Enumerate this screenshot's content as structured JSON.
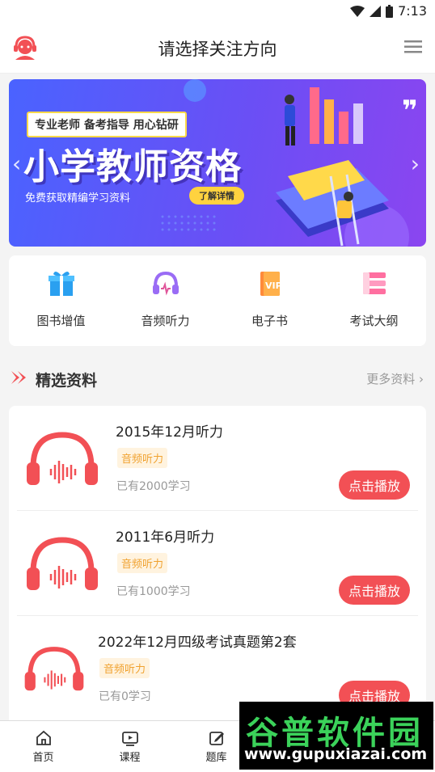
{
  "status": {
    "time": "7:13"
  },
  "header": {
    "title": "请选择关注方向"
  },
  "banner": {
    "tag": "专业老师 备考指导 用心钻研",
    "headline": "小学教师资格",
    "subtitle": "免费获取精编学习资料",
    "detail_button": "了解详情"
  },
  "quick_links": [
    {
      "label": "图书增值",
      "icon": "gift-box-icon"
    },
    {
      "label": "音频听力",
      "icon": "headphones-icon"
    },
    {
      "label": "电子书",
      "icon": "vip-book-icon"
    },
    {
      "label": "考试大纲",
      "icon": "outline-list-icon"
    }
  ],
  "section": {
    "title": "精选资料",
    "more": "更多资料"
  },
  "materials": [
    {
      "title": "2015年12月听力",
      "tag": "音频听力",
      "count": "已有2000学习",
      "action": "点击播放"
    },
    {
      "title": "2011年6月听力",
      "tag": "音频听力",
      "count": "已有1000学习",
      "action": "点击播放"
    },
    {
      "title": "2022年12月四级考试真题第2套",
      "tag": "音频听力",
      "count": "已有0学习",
      "action": "点击播放"
    }
  ],
  "tabs": [
    {
      "label": "首页",
      "icon": "home-icon"
    },
    {
      "label": "课程",
      "icon": "video-icon"
    },
    {
      "label": "题库",
      "icon": "edit-icon"
    }
  ],
  "watermark": {
    "cn": "谷普软件园",
    "url": "www.gupuxiazai.com"
  },
  "colors": {
    "accent": "#f25055",
    "banner": "#5a5af5",
    "tag": "#f0a230"
  }
}
